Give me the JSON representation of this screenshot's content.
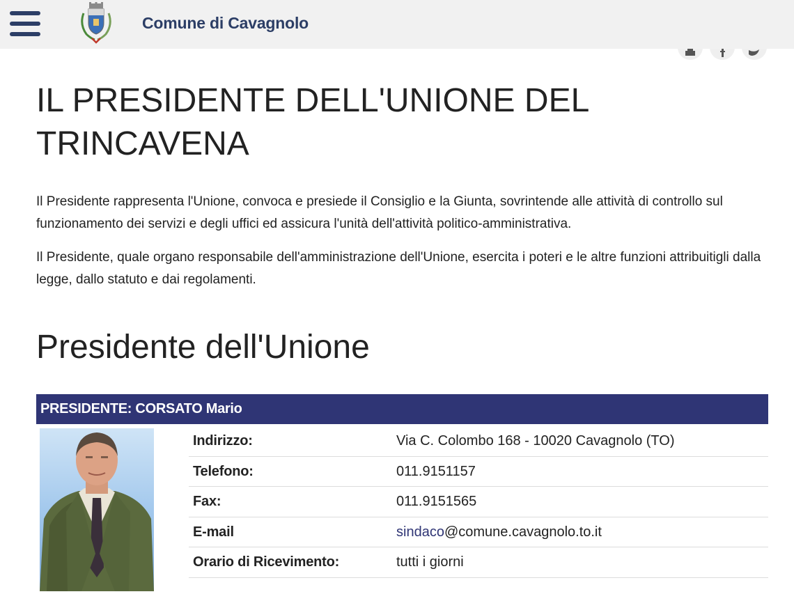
{
  "header": {
    "site_title": "Comune di Cavagnolo",
    "menu_icon": "hamburger-icon",
    "crest_icon": "coat-of-arms-icon",
    "brand_color": "#2c3e66"
  },
  "share": {
    "icons": [
      "print-icon",
      "facebook-icon",
      "twitter-icon"
    ]
  },
  "main": {
    "title": "IL PRESIDENTE DELL'UNIONE DEL TRINCAVENA",
    "paragraphs": [
      "Il Presidente rappresenta l'Unione, convoca e presiede il Consiglio e la Giunta, sovrintende alle attività di controllo sul funzionamento dei servizi e degli uffici ed assicura l'unità dell'attività politico-amministrativa.",
      "Il Presidente, quale organo responsabile dell'amministrazione dell'Unione, esercita i poteri e le altre funzioni attribuitigli dalla legge, dallo statuto e dai regolamenti."
    ],
    "section_title": "Presidente dell'Unione"
  },
  "card": {
    "header": "PRESIDENTE: CORSATO Mario",
    "header_color": "#2f3575",
    "rows": [
      {
        "label": "Indirizzo:",
        "value": "Via C. Colombo 168 - 10020 Cavagnolo (TO)"
      },
      {
        "label": "Telefono:",
        "value": "011.9151157"
      },
      {
        "label": "Fax:",
        "value": "011.9151565"
      },
      {
        "label": "E-mail",
        "link_text": "sindaco",
        "value": "@comune.cavagnolo.to.it"
      },
      {
        "label": "Orario di Ricevimento:",
        "value": "tutti i giorni"
      }
    ]
  }
}
